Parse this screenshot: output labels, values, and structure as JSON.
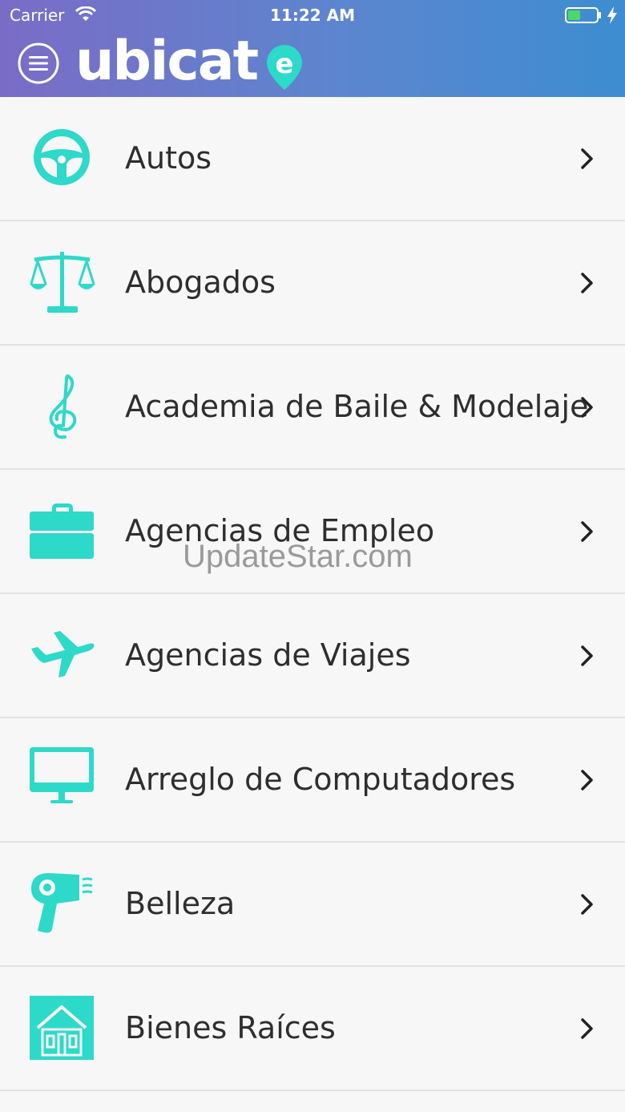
{
  "status_bar": {
    "carrier": "Carrier",
    "time": "11:22 AM",
    "icons": [
      "wifi-icon",
      "battery-icon",
      "charging-bolt-icon"
    ]
  },
  "header": {
    "logo_text": "ubicat",
    "logo_suffix": "e",
    "menu_icon": "hamburger-menu-icon",
    "gradient_start": "#7a6cc6",
    "gradient_end": "#3d8dd0"
  },
  "accent_color": "#2dd9c9",
  "categories": [
    {
      "label": "Autos",
      "icon": "steering-wheel-icon"
    },
    {
      "label": "Abogados",
      "icon": "scales-icon"
    },
    {
      "label": "Academia de Baile & Modelaje",
      "icon": "treble-clef-icon"
    },
    {
      "label": "Agencias de Empleo",
      "icon": "briefcase-icon"
    },
    {
      "label": "Agencias de Viajes",
      "icon": "airplane-icon"
    },
    {
      "label": "Arreglo de Computadores",
      "icon": "monitor-icon"
    },
    {
      "label": "Belleza",
      "icon": "hair-dryer-icon"
    },
    {
      "label": "Bienes Raíces",
      "icon": "house-icon"
    }
  ],
  "watermark": "UpdateStar.com"
}
